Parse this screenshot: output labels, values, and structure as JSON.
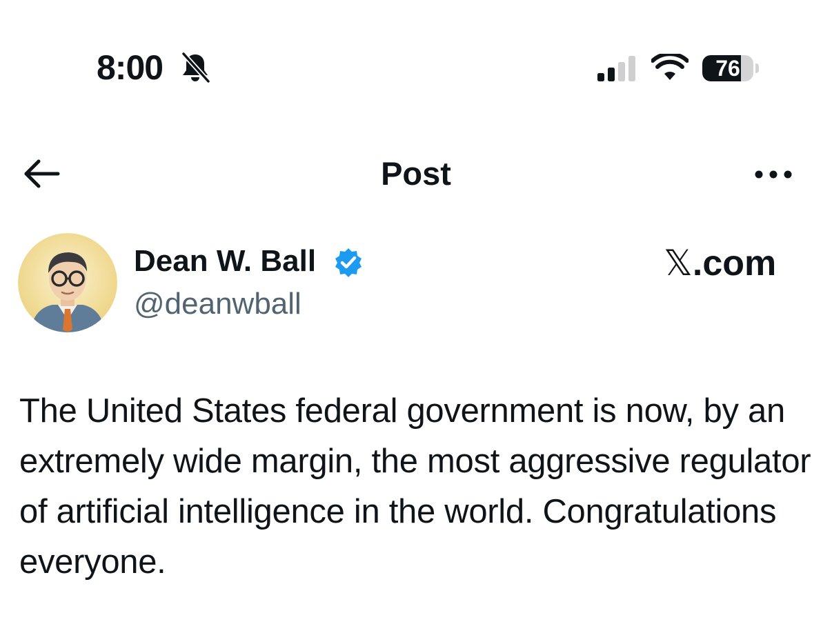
{
  "status_bar": {
    "time": "8:00",
    "battery_percent": 76,
    "battery_label": "76",
    "icons": [
      "bell-slash-icon",
      "signal-icon",
      "wifi-icon",
      "battery-icon"
    ]
  },
  "nav": {
    "title": "Post",
    "back_icon": "arrow-left-icon",
    "more_icon": "more-horizontal-icon"
  },
  "author": {
    "name": "Dean W. Ball",
    "handle": "@deanwball",
    "verified": true,
    "verified_color": "#1d9bf0"
  },
  "brand": {
    "x_logo": "𝕏",
    "domain": ".com"
  },
  "post": {
    "text": "The United States federal government is now, by an extremely wide margin, the most aggressive regulator of artificial intelligence in the world. Congratulations everyone."
  },
  "colors": {
    "text_primary": "#0f1419",
    "text_secondary": "#536471",
    "accent": "#1d9bf0"
  }
}
